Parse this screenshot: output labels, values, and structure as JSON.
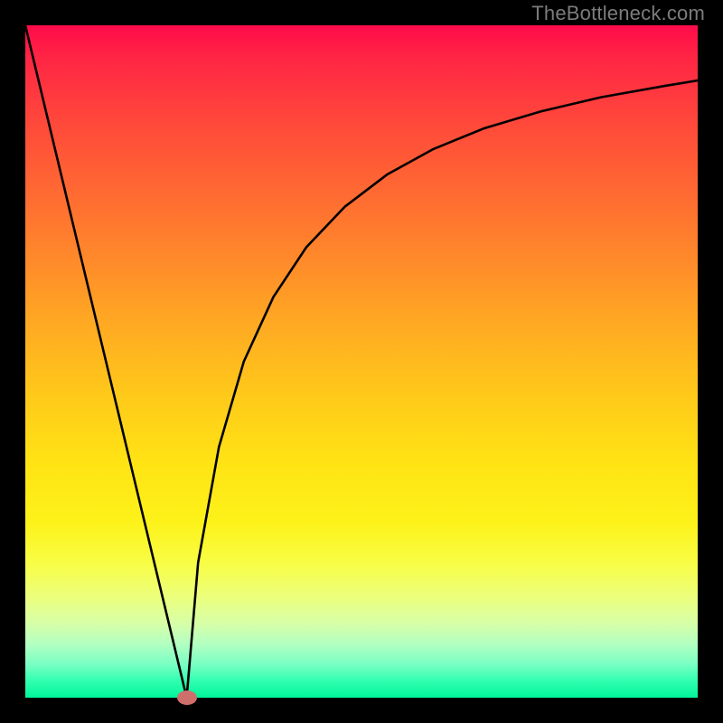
{
  "watermark": "TheBottleneck.com",
  "colors": {
    "frame": "#000000",
    "curve": "#000000",
    "marker": "#cf6f6c",
    "gradient_top": "#ff0b4a",
    "gradient_bottom": "#00f59a"
  },
  "chart_data": {
    "type": "line",
    "title": "",
    "xlabel": "",
    "ylabel": "",
    "xlim": [
      0,
      100
    ],
    "ylim": [
      0,
      100
    ],
    "left_segment": {
      "x": [
        0,
        24
      ],
      "y": [
        100,
        0
      ]
    },
    "right_segment_x": [
      24,
      25.7,
      28.8,
      32.5,
      36.9,
      41.8,
      47.5,
      53.8,
      60.7,
      68.3,
      76.7,
      85.6,
      95.2,
      100.0
    ],
    "right_segment_y": [
      0,
      20.1,
      37.3,
      50.0,
      59.6,
      67.0,
      73.0,
      77.8,
      81.6,
      84.7,
      87.2,
      89.3,
      91.0,
      91.8
    ],
    "marker": {
      "x": 24,
      "y": 0
    },
    "grid": false,
    "legend": false
  }
}
